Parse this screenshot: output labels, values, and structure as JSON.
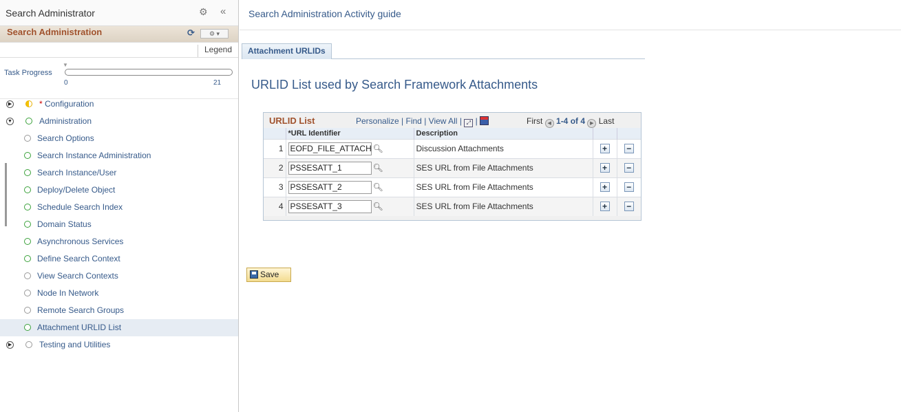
{
  "left_panel": {
    "title": "Search Administrator",
    "gear_icon": "gear-icon",
    "collapse_icon": "«",
    "guide_title": "Search Administration",
    "refresh_icon": "⟳",
    "menu_icon": "⚙ ▾",
    "legend": "Legend",
    "task_progress": {
      "label": "Task Progress",
      "min": "0",
      "max": "21",
      "value": 0
    },
    "tree": [
      {
        "label": "Configuration",
        "required": "*",
        "status": "half",
        "expander": "▶",
        "level": 0
      },
      {
        "label": "Administration",
        "required": "",
        "status": "green",
        "expander": "▼",
        "level": 0
      },
      {
        "label": "Search Options",
        "status": "grey",
        "level": 1
      },
      {
        "label": "Search Instance Administration",
        "status": "green",
        "level": 1
      },
      {
        "label": "Search Instance/User",
        "status": "green",
        "level": 1
      },
      {
        "label": "Deploy/Delete Object",
        "status": "green",
        "level": 1
      },
      {
        "label": "Schedule Search Index",
        "status": "green",
        "level": 1
      },
      {
        "label": "Domain Status",
        "status": "green",
        "level": 1
      },
      {
        "label": "Asynchronous Services",
        "status": "green",
        "level": 1
      },
      {
        "label": "Define Search Context",
        "status": "green",
        "level": 1
      },
      {
        "label": "View Search Contexts",
        "status": "grey",
        "level": 1
      },
      {
        "label": "Node In Network",
        "status": "grey",
        "level": 1
      },
      {
        "label": "Remote Search Groups",
        "status": "grey",
        "level": 1
      },
      {
        "label": "Attachment URLID List",
        "status": "green",
        "level": 1,
        "selected": true
      },
      {
        "label": "Testing and Utilities",
        "required": "",
        "status": "grey",
        "expander": "▶",
        "level": 0
      }
    ]
  },
  "header": {
    "activity_title": "Search Administration Activity guide"
  },
  "tab": {
    "label": "Attachment URLIDs"
  },
  "page_title": "URLID List used by Search Framework Attachments",
  "grid": {
    "title": "URLID List",
    "personalize": "Personalize",
    "find": "Find",
    "view_all": "View All",
    "first": "First",
    "count": "1-4 of 4",
    "last": "Last",
    "columns": [
      "*URL Identifier",
      "Description"
    ],
    "rows": [
      {
        "num": "1",
        "url_id": "EOFD_FILE_ATTACH",
        "description": "Discussion Attachments"
      },
      {
        "num": "2",
        "url_id": "PSSESATT_1",
        "description": "SES URL from File Attachments"
      },
      {
        "num": "3",
        "url_id": "PSSESATT_2",
        "description": "SES URL from File Attachments"
      },
      {
        "num": "4",
        "url_id": "PSSESATT_3",
        "description": "SES URL from File Attachments"
      }
    ]
  },
  "save_label": "Save",
  "colors": {
    "link_blue": "#365a8a",
    "guide_brown": "#a0522d",
    "status_green": "#3aa13a",
    "status_yellow": "#f5c400"
  }
}
